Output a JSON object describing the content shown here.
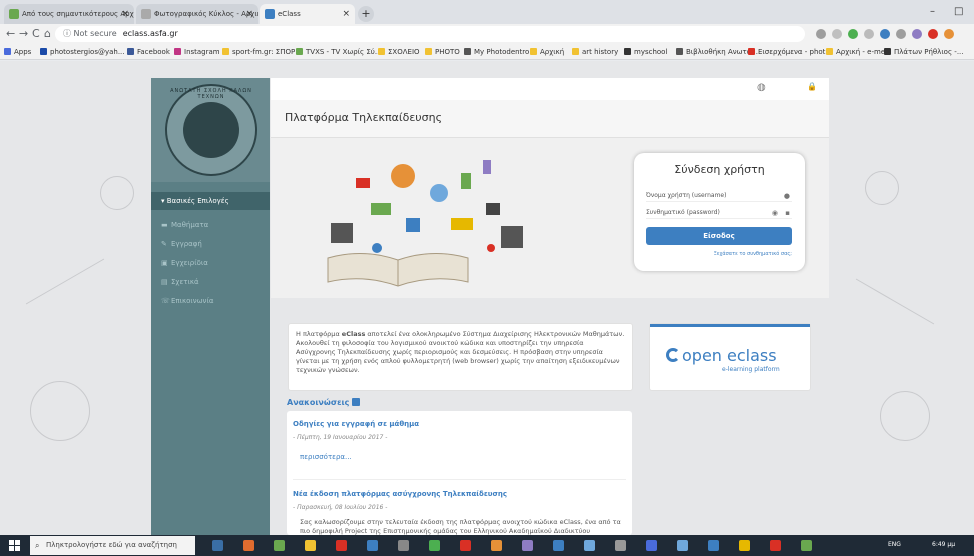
{
  "browser": {
    "tabs": [
      {
        "label": "Από τους σημαντικότερους Αρχ",
        "active": false,
        "favicon_color": "#6aa84f"
      },
      {
        "label": "Φωτογραφικός Κύκλος - Αρχική",
        "active": false,
        "favicon_color": "#aaaaaa"
      },
      {
        "label": "eClass",
        "active": true,
        "favicon_color": "#3d7fc1"
      }
    ],
    "new_tab": "+",
    "window_controls": {
      "minimize": "–",
      "maximize": "□"
    },
    "nav": {
      "back": "←",
      "forward": "→",
      "reload": "C",
      "home": "⌂"
    },
    "address": {
      "security": "ⓘ Not secure",
      "url": "eclass.asfa.gr"
    },
    "bookmarks": [
      {
        "label": "Apps",
        "color": "#4a6bdc"
      },
      {
        "label": "photostergios@yah...",
        "color": "#1a4aa8"
      },
      {
        "label": "Facebook",
        "color": "#3b5998"
      },
      {
        "label": "Instagram",
        "color": "#c13584"
      },
      {
        "label": "sport-fm.gr: ΣΠΟΡ...",
        "color": "#f1c232"
      },
      {
        "label": "TVXS - TV Χωρίς Σύ...",
        "color": "#6aa84f"
      },
      {
        "label": "ΣΧΟΛΕΙΟ",
        "color": "#f1c232"
      },
      {
        "label": "PHOTO",
        "color": "#f1c232"
      },
      {
        "label": "My Photodentro",
        "color": "#555555"
      },
      {
        "label": "Αρχική",
        "color": "#f1c232"
      },
      {
        "label": "art history",
        "color": "#f1c232"
      },
      {
        "label": "myschool",
        "color": "#333333"
      },
      {
        "label": "Βιβλιοθήκη Ανωτά...",
        "color": "#555555"
      },
      {
        "label": "Εισερχόμενα - phot...",
        "color": "#d93025"
      },
      {
        "label": "Αρχική - e-me",
        "color": "#f1c232"
      },
      {
        "label": "Πλάτων Ρήθλιος -...",
        "color": "#333333"
      }
    ]
  },
  "sidebar": {
    "seal_text": "ΑΝΩΤΑΤΗ ΣΧΟΛΗ ΚΑΛΩΝ ΤΕΧΝΩΝ",
    "menu_header": "Βασικές Επιλογές",
    "items": [
      {
        "icon": "▬",
        "label": "Μαθήματα"
      },
      {
        "icon": "✎",
        "label": "Εγγραφή"
      },
      {
        "icon": "▣",
        "label": "Εγχειρίδια"
      },
      {
        "icon": "▤",
        "label": "Σχετικά"
      },
      {
        "icon": "☏",
        "label": "Επικοινωνία"
      }
    ]
  },
  "topbar": {
    "globe_icon": "◍",
    "lock_icon": "🔒"
  },
  "page_title": "Πλατφόρμα Τηλεκπαίδευσης",
  "login": {
    "title": "Σύνδεση χρήστη",
    "username_placeholder": "Όνομα χρήστη (username)",
    "password_placeholder": "Συνθηματικό (password)",
    "submit": "Είσοδος",
    "forgot": "Ξεχάσατε το συνθηματικό σας;"
  },
  "intro": {
    "brand": "eClass",
    "text_before": "Η πλατφόρμα ",
    "text_after": " αποτελεί ένα ολοκληρωμένο Σύστημα Διαχείρισης Ηλεκτρονικών Μαθημάτων. Ακολουθεί τη φιλοσοφία του λογισμικού ανοικτού κώδικα και υποστηρίζει την υπηρεσία Ασύγχρονης Τηλεκπαίδευσης χωρίς περιορισμούς και δεσμεύσεις. Η πρόσβαση στην υπηρεσία γίνεται με τη χρήση ενός απλού φυλλομετρητή (web browser) χωρίς την απαίτηση εξειδικευμένων τεχνικών γνώσεων."
  },
  "logo": {
    "name": "open eclass",
    "tagline": "e-learning platform"
  },
  "announcements": {
    "heading": "Ανακοινώσεις",
    "items": [
      {
        "title": "Οδηγίες για εγγραφή σε μάθημα",
        "date": "- Πέμπτη, 19 Ιανουαρίου 2017 -",
        "more": "περισσότερα..."
      },
      {
        "title": "Νέα έκδοση πλατφόρμας ασύγχρονης Τηλεκπαίδευσης",
        "date": "- Παρασκευή, 08 Ιουλίου 2016 -",
        "text": "Σας καλωσορίζουμε στην τελευταία έκδοση της πλατφόρμας ανοιχτού κώδικα eClass, ένα από τα πιο δημοφιλή Project της Επιστημονικής ομάδας του Ελληνικού Ακαδημαϊκού Διαδικτύου"
      }
    ]
  },
  "taskbar": {
    "search_placeholder": "Πληκτρολογήστε εδώ για αναζήτηση",
    "apps": [
      "#3a6ea5",
      "#e06c2f",
      "#6aa84f",
      "#f1c232",
      "#d93025",
      "#3d7fc1",
      "#888888",
      "#4caf50",
      "#d93025",
      "#e69138",
      "#8e7cc3",
      "#3d7fc1",
      "#6fa8dc",
      "#999999",
      "#4a6bdc",
      "#6fa8dc",
      "#3d7fc1",
      "#e6b800",
      "#d93025",
      "#6aa84f"
    ],
    "language": "ENG",
    "time": "6:49 μμ"
  },
  "colors": {
    "accent": "#3d7fc1",
    "sidebar": "#5b7f85",
    "sidebar_header": "#40646a"
  }
}
